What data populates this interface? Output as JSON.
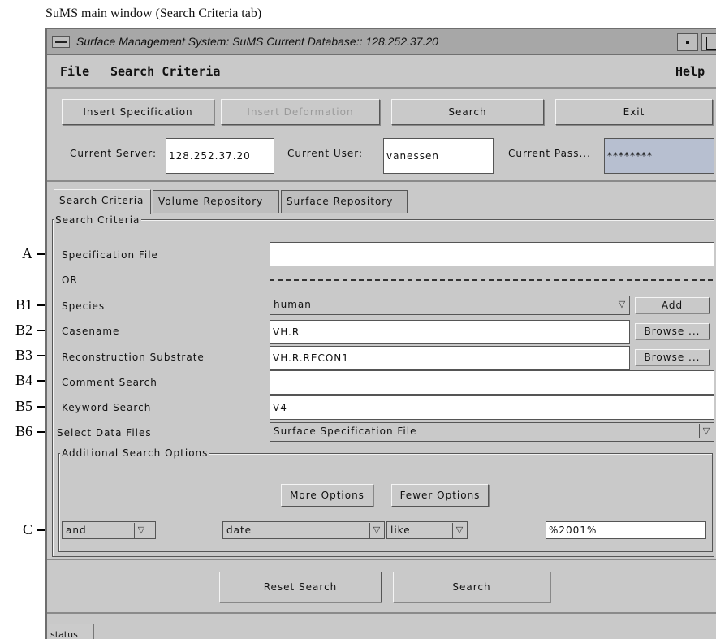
{
  "caption": "SuMS main window (Search Criteria tab)",
  "callouts": {
    "a": "A",
    "b1": "B1",
    "b2": "B2",
    "b3": "B3",
    "b4": "B4",
    "b5": "B5",
    "b6": "B6",
    "c": "C"
  },
  "window": {
    "title": "Surface Management System: SuMS Current Database:: 128.252.37.20"
  },
  "menubar": {
    "file": "File",
    "search_criteria": "Search Criteria",
    "help": "Help"
  },
  "toolbar": {
    "insert_specification": "Insert Specification",
    "insert_deformation": "Insert Deformation",
    "search": "Search",
    "exit": "Exit"
  },
  "connection": {
    "server_label": "Current Server:",
    "server_value": "128.252.37.20",
    "user_label": "Current User:",
    "user_value": "vanessen",
    "pass_label": "Current Pass...",
    "pass_value": "********"
  },
  "tabs": {
    "search_criteria": "Search Criteria",
    "volume_repository": "Volume Repository",
    "surface_repository": "Surface Repository"
  },
  "criteria": {
    "group_title": "Search Criteria",
    "specification_file_label": "Specification File",
    "specification_file_value": "",
    "or_label": "OR",
    "species_label": "Species",
    "species_value": "human",
    "add_button": "Add",
    "casename_label": "Casename",
    "casename_value": "VH.R",
    "browse_button": "Browse ...",
    "substrate_label": "Reconstruction Substrate",
    "substrate_value": "VH.R.RECON1",
    "comment_label": "Comment Search",
    "comment_value": "",
    "keyword_label": "Keyword Search",
    "keyword_value": "V4",
    "data_files_label": "Select Data Files",
    "data_files_value": "Surface Specification File"
  },
  "additional": {
    "group_title": "Additional Search Options",
    "more_options": "More Options",
    "fewer_options": "Fewer Options",
    "conjunction": "and",
    "field": "date",
    "operator": "like",
    "value": "%2001%"
  },
  "bottom": {
    "reset_search": "Reset Search",
    "search": "Search"
  },
  "status": {
    "label": "status",
    "text": ""
  },
  "colors": {
    "window_bg": "#c9c9c9",
    "titlebar_bg": "#a7a7a7",
    "password_bg": "#b7bfd0",
    "input_bg": "#ffffff"
  }
}
